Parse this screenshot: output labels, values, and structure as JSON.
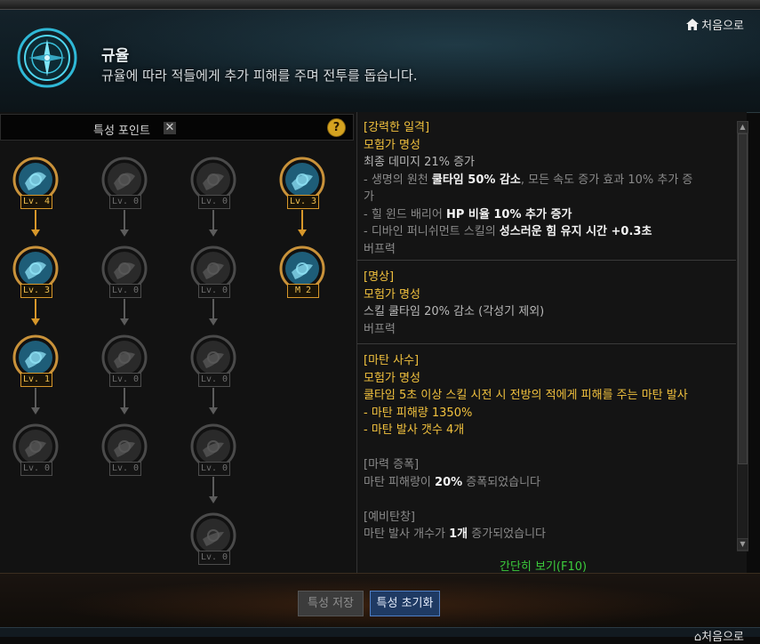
{
  "header": {
    "title": "규율",
    "subtitle": "규율에 따라 적들에게 추가 피해를 주며 전투를 돕습니다.",
    "home_label": "처음으로"
  },
  "points": {
    "label": "특성 포인트",
    "x_icon": "✕",
    "help": "?"
  },
  "tree": {
    "columns": [
      {
        "nodes": [
          {
            "icon": "ice-burst-icon",
            "level": "Lv. 4",
            "active": true
          },
          {
            "icon": "frost-orb-icon",
            "level": "Lv. 3",
            "active": true
          },
          {
            "icon": "ice-block-icon",
            "level": "Lv. 1",
            "active": true
          },
          {
            "icon": "wind-slash-icon",
            "level": "Lv. 0",
            "active": false
          }
        ]
      },
      {
        "nodes": [
          {
            "icon": "claw-strike-icon",
            "level": "Lv. 0",
            "active": false
          },
          {
            "icon": "demon-mask-icon",
            "level": "Lv. 0",
            "active": false
          },
          {
            "icon": "vortex-icon",
            "level": "Lv. 0",
            "active": false
          },
          {
            "icon": "star-burst-icon",
            "level": "Lv. 0",
            "active": false
          }
        ]
      },
      {
        "nodes": [
          {
            "icon": "fireball-icon",
            "level": "Lv. 0",
            "active": false
          },
          {
            "icon": "dark-ring-icon",
            "level": "Lv. 0",
            "active": false
          },
          {
            "icon": "whirlwind-icon",
            "level": "Lv. 0",
            "active": false
          },
          {
            "icon": "shatter-icon",
            "level": "Lv. 0",
            "active": false
          },
          {
            "icon": "orb-cluster-icon",
            "level": "Lv. 0",
            "active": false
          }
        ]
      },
      {
        "nodes": [
          {
            "icon": "sword-icon",
            "level": "Lv. 3",
            "active": true
          },
          {
            "icon": "rune-icon",
            "level": "M 2",
            "active": true
          }
        ]
      }
    ]
  },
  "description": {
    "blocks": [
      {
        "lines": [
          [
            {
              "t": "[강력한 일격]",
              "c": "y"
            }
          ],
          [
            {
              "t": "모험가 명성",
              "c": "y"
            }
          ],
          [
            {
              "t": "최종 데미지 21% 증가",
              "c": "d"
            }
          ],
          [
            {
              "t": "- 생명의 원천 ",
              "c": "g"
            },
            {
              "t": "쿨타임 50% 감소",
              "c": "w"
            },
            {
              "t": ", 모든 속도 증가 효과 10% 추가 증",
              "c": "g"
            }
          ],
          [
            {
              "t": "가",
              "c": "g"
            }
          ],
          [
            {
              "t": "- 힐 윈드 배리어 ",
              "c": "g"
            },
            {
              "t": "HP 비율 10% 추가 증가",
              "c": "w"
            }
          ],
          [
            {
              "t": "- 디바인 퍼니쉬먼트 스킬의 ",
              "c": "g"
            },
            {
              "t": "성스러운 힘 유지 시간 +0.3초",
              "c": "w"
            }
          ],
          [
            {
              "t": "버프력",
              "c": "g"
            }
          ]
        ]
      },
      {
        "lines": [
          [
            {
              "t": "[명상]",
              "c": "y"
            }
          ],
          [
            {
              "t": "모험가 명성",
              "c": "y"
            }
          ],
          [
            {
              "t": "스킬 쿨타임 20% 감소 (각성기 제외)",
              "c": "d"
            }
          ],
          [
            {
              "t": "버프력",
              "c": "g"
            }
          ]
        ]
      },
      {
        "lines": [
          [
            {
              "t": "[마탄 사수]",
              "c": "y"
            }
          ],
          [
            {
              "t": "모험가 명성",
              "c": "y"
            }
          ],
          [
            {
              "t": "쿨타임 5초 이상 스킬 시전 시 전방의 적에게 피해를 주는 마탄 발사",
              "c": "y"
            }
          ],
          [
            {
              "t": "- 마탄 피해량 1350%",
              "c": "y"
            }
          ],
          [
            {
              "t": "- 마탄 발사 갯수 4개",
              "c": "y"
            }
          ],
          [
            {
              "t": "",
              "c": "d"
            }
          ],
          [
            {
              "t": "[마력 증폭]",
              "c": "g"
            }
          ],
          [
            {
              "t": "마탄 피해량이 ",
              "c": "g"
            },
            {
              "t": "20%",
              "c": "w"
            },
            {
              "t": " 증폭되었습니다",
              "c": "g"
            }
          ],
          [
            {
              "t": "",
              "c": "d"
            }
          ],
          [
            {
              "t": "[예비탄창]",
              "c": "g"
            }
          ],
          [
            {
              "t": "마탄 발사 개수가 ",
              "c": "g"
            },
            {
              "t": "1개",
              "c": "w"
            },
            {
              "t": " 증가되었습니다",
              "c": "g"
            }
          ]
        ]
      }
    ],
    "brief_label": "간단히 보기(F10)"
  },
  "buttons": {
    "save": "특성 저장",
    "reset": "특성 초기화"
  },
  "colors": {
    "active_level": "#f0c050",
    "brief": "#3ccc3c",
    "reset_bg": "#1f3a63"
  }
}
